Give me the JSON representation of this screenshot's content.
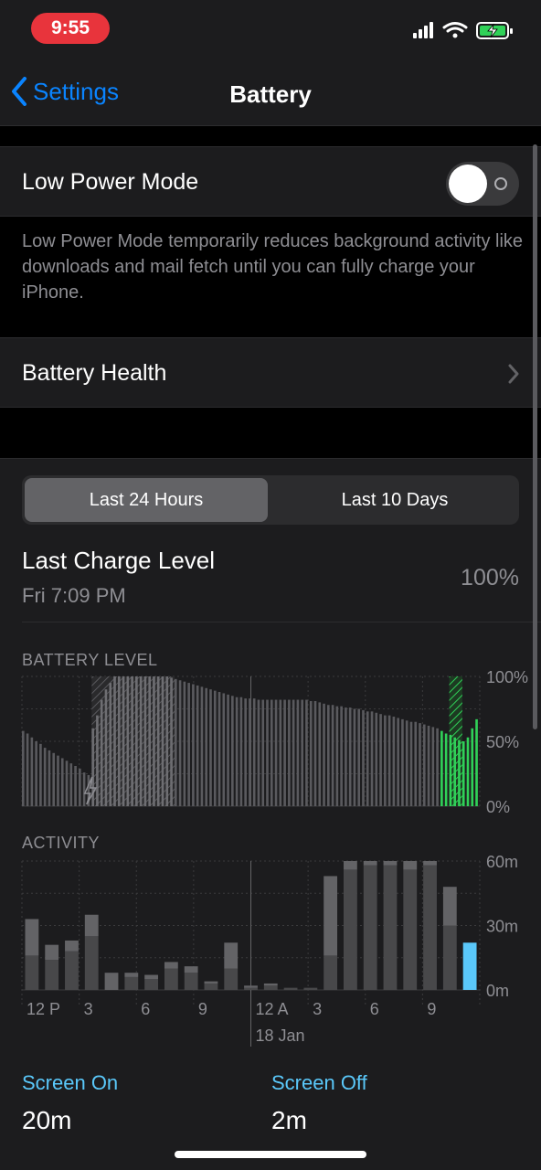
{
  "status_bar": {
    "time": "9:55",
    "icons": [
      "cellular-signal-icon",
      "wifi-icon",
      "battery-charging-icon"
    ]
  },
  "nav": {
    "back_label": "Settings",
    "title": "Battery"
  },
  "low_power": {
    "label": "Low Power Mode",
    "enabled": false,
    "footnote": "Low Power Mode temporarily reduces background activity like downloads and mail fetch until you can fully charge your iPhone."
  },
  "battery_health": {
    "label": "Battery Health"
  },
  "segmented": {
    "options": [
      "Last 24 Hours",
      "Last 10 Days"
    ],
    "selected": 0
  },
  "last_charge": {
    "title": "Last Charge Level",
    "date": "Fri 7:09 PM",
    "value": "100%"
  },
  "colors": {
    "accent": "#0a84ff",
    "green": "#30d158",
    "blue_bar": "#1a7cf5",
    "legend": "#5ac8fa"
  },
  "chart_data": [
    {
      "type": "bar",
      "title": "BATTERY LEVEL",
      "yticks": [
        "100%",
        "50%",
        "0%"
      ],
      "ylim": [
        0,
        100
      ],
      "values": [
        58,
        56,
        53,
        50,
        48,
        45,
        43,
        41,
        39,
        37,
        35,
        33,
        31,
        29,
        26,
        24,
        60,
        70,
        82,
        90,
        95,
        100,
        100,
        100,
        100,
        100,
        100,
        100,
        100,
        100,
        100,
        100,
        100,
        100,
        99,
        98,
        97,
        96,
        95,
        94,
        93,
        92,
        91,
        90,
        89,
        88,
        87,
        86,
        85,
        84,
        84,
        83,
        83,
        83,
        82,
        82,
        82,
        82,
        82,
        82,
        82,
        82,
        82,
        82,
        82,
        82,
        81,
        81,
        80,
        79,
        78,
        78,
        77,
        77,
        76,
        76,
        75,
        75,
        74,
        73,
        73,
        72,
        71,
        70,
        70,
        69,
        68,
        67,
        66,
        65,
        65,
        64,
        63,
        62,
        61,
        60,
        58,
        56,
        55,
        53,
        51,
        50,
        53,
        60,
        67
      ],
      "charging_ranges": [
        [
          16,
          34
        ],
        [
          98,
          100
        ]
      ],
      "green_from": 96
    },
    {
      "type": "bar",
      "title": "ACTIVITY",
      "yticks": [
        "60m",
        "30m",
        "0m"
      ],
      "ylim": [
        0,
        60
      ],
      "xticks": [
        "12 P",
        "3",
        "6",
        "9",
        "12 A",
        "3",
        "6",
        "9"
      ],
      "date_label": "18 Jan",
      "series": [
        {
          "name": "Screen On",
          "values": [
            16,
            14,
            18,
            25,
            0,
            6,
            5,
            10,
            8,
            3,
            10,
            1,
            2,
            1,
            1,
            16,
            56,
            58,
            58,
            56,
            58,
            30,
            0
          ]
        },
        {
          "name": "Screen Off",
          "values": [
            17,
            7,
            5,
            10,
            8,
            2,
            2,
            3,
            3,
            1,
            12,
            1,
            1,
            0,
            0,
            37,
            4,
            2,
            2,
            4,
            2,
            18,
            22
          ]
        }
      ],
      "highlight_index": 22
    }
  ],
  "legend": [
    {
      "label": "Screen On",
      "value": "20m"
    },
    {
      "label": "Screen Off",
      "value": "2m"
    }
  ]
}
